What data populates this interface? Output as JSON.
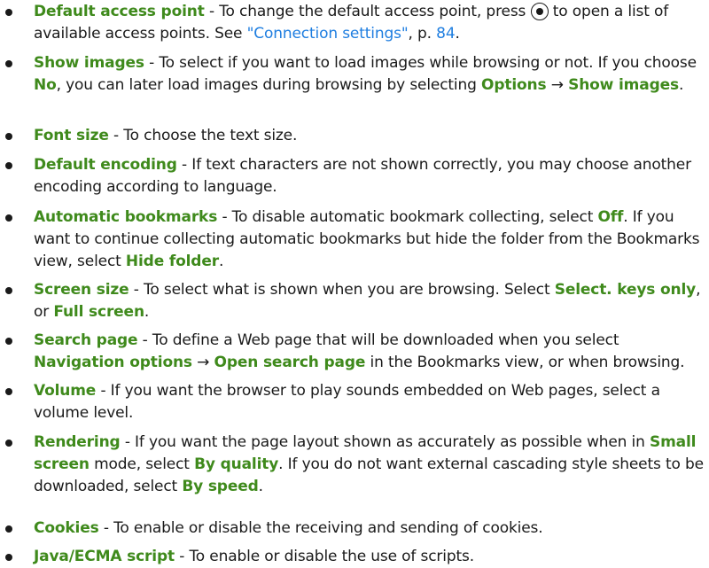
{
  "arrow": "→",
  "items": [
    {
      "term": "Default access point",
      "t1": " - To change the default access point, press ",
      "t2": " to open a list of available access points. See ",
      "link": "\"Connection settings\"",
      "t3": ", p. ",
      "page": "84",
      "t4": "."
    },
    {
      "term": "Show images",
      "t1": " - To select if you want to load images while browsing or not. If you choose ",
      "k1": "No",
      "t2": ", you can later load images during browsing by selecting ",
      "k2": "Options",
      "k3": "Show images",
      "t3": "."
    },
    {
      "term": "Font size",
      "t1": " - To choose the text size."
    },
    {
      "term": "Default encoding",
      "t1": " - If text characters are not shown correctly, you may choose another encoding according to language."
    },
    {
      "term": "Automatic bookmarks",
      "t1": " - To disable automatic bookmark collecting, select ",
      "k1": "Off",
      "t2": ". If you want to continue collecting automatic bookmarks but hide the folder from the Bookmarks view, select ",
      "k2": "Hide folder",
      "t3": "."
    },
    {
      "term": "Screen size",
      "t1": " - To select what is shown when you are browsing. Select ",
      "k1": "Select. keys only",
      "t2": ", or ",
      "k2": "Full screen",
      "t3": "."
    },
    {
      "term": "Search page",
      "t1": " - To define a Web page that will be downloaded when you select ",
      "k1": "Navigation options",
      "k2": "Open search page",
      "t2": " in the Bookmarks view, or when browsing."
    },
    {
      "term": "Volume",
      "t1": " - If you want the browser to play sounds embedded on Web pages, select a volume level."
    },
    {
      "term": "Rendering",
      "t1": " - If you want the page layout shown as accurately as possible when in ",
      "k1": "Small screen",
      "t2": " mode, select ",
      "k2": "By quality",
      "t3": ". If you do not want external cascading style sheets to be downloaded, select ",
      "k3": "By speed",
      "t4": "."
    },
    {
      "term": "Cookies",
      "t1": " - To enable or disable the receiving and sending of cookies."
    },
    {
      "term": "Java/ECMA script",
      "t1": " - To enable or disable the use of scripts."
    }
  ]
}
